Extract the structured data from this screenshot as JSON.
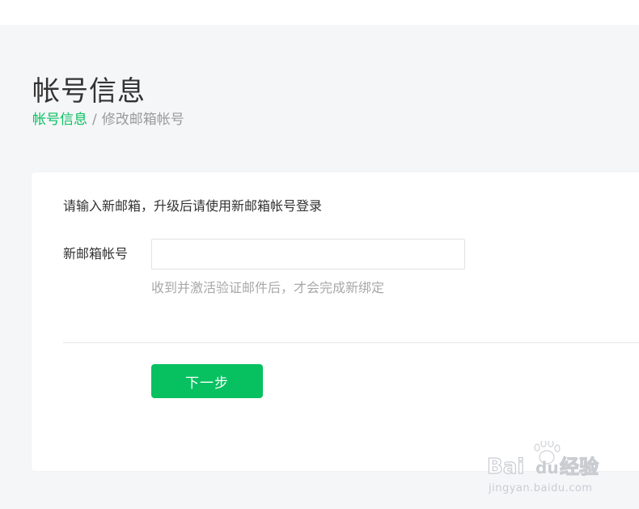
{
  "header": {
    "title": "帐号信息"
  },
  "breadcrumb": {
    "parent": "帐号信息",
    "separator": "/",
    "current": "修改邮箱帐号"
  },
  "form": {
    "instruction": "请输入新邮箱，升级后请使用新邮箱帐号登录",
    "email_label": "新邮箱帐号",
    "email_value": "",
    "email_placeholder": "",
    "hint": "收到并激活验证邮件后，才会完成新绑定",
    "next_label": "下一步"
  },
  "watermark": {
    "brand": "Baidu经验",
    "url": "jingyan.baidu.com"
  },
  "colors": {
    "accent": "#07c160",
    "background": "#f5f6f8",
    "card": "#ffffff",
    "text": "#333333",
    "muted": "#a8a8a8"
  }
}
